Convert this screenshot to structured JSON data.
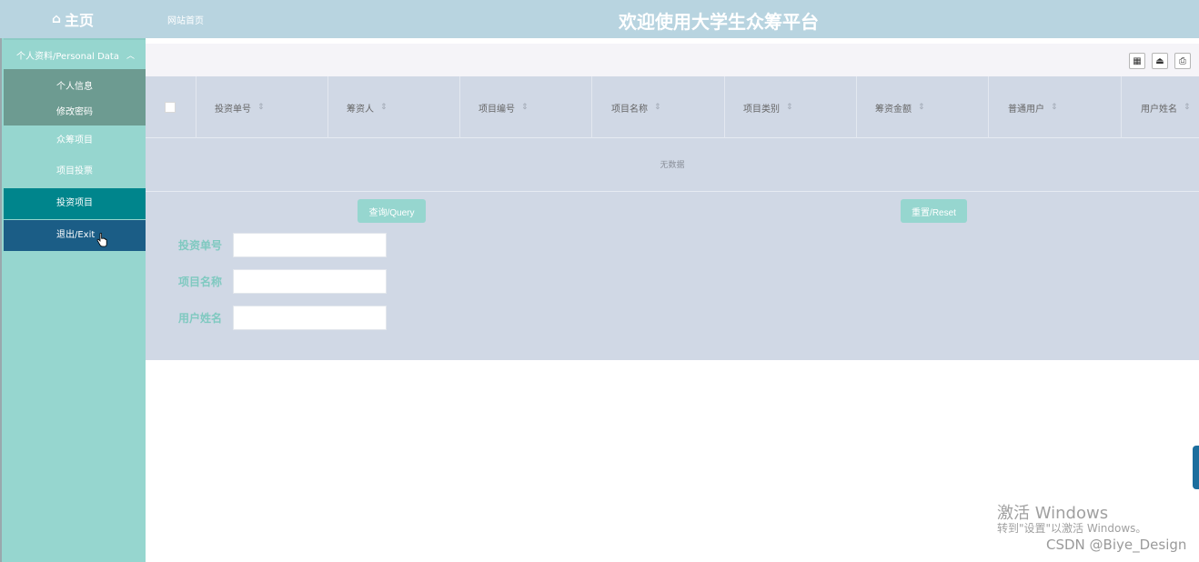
{
  "header": {
    "home_label": "主页",
    "site_home_link": "网站首页",
    "title": "欢迎使用大学生众筹平台"
  },
  "sidebar": {
    "group_label": "个人资料/Personal Data",
    "sub_items": [
      "个人信息",
      "修改密码"
    ],
    "items": [
      "众筹项目",
      "项目投票",
      "投资项目",
      "退出/Exit"
    ]
  },
  "table": {
    "columns": [
      "投资单号",
      "筹资人",
      "项目编号",
      "项目名称",
      "项目类别",
      "筹资金额",
      "普通用户",
      "用户姓名"
    ],
    "empty_text": "无数据"
  },
  "buttons": {
    "query": "查询/Query",
    "reset": "重置/Reset"
  },
  "search_form": {
    "fields": [
      "投资单号",
      "项目名称",
      "用户姓名"
    ]
  },
  "overlay": {
    "activate_title": "激活 Windows",
    "activate_sub": "转到\"设置\"以激活 Windows。",
    "watermark": "CSDN @Biye_Design"
  }
}
